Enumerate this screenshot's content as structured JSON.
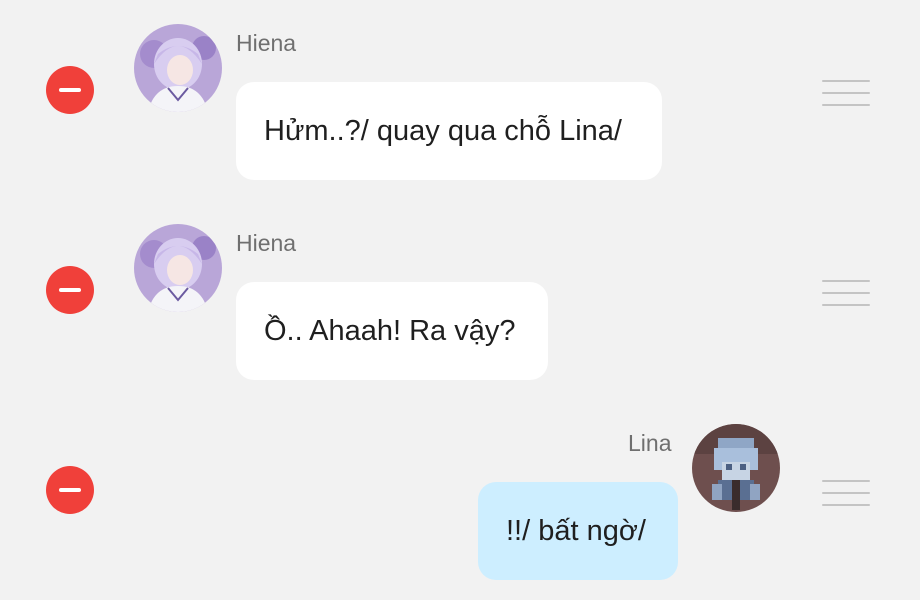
{
  "messages": [
    {
      "sender": "Hiena",
      "text": "Hửm..?/ quay qua chỗ Lina/",
      "side": "left"
    },
    {
      "sender": "Hiena",
      "text": "Ồ.. Ahaah! Ra vậy?",
      "side": "left"
    },
    {
      "sender": "Lina",
      "text": "!!/ bất ngờ/",
      "side": "right"
    }
  ],
  "colors": {
    "background": "#f2f2f2",
    "delete": "#f0403a",
    "incoming_bubble": "#ffffff",
    "outgoing_bubble": "#cdeeff",
    "sender_text": "#6f6f6f"
  },
  "icons": {
    "delete": "minus-circle-icon",
    "reorder": "drag-handle-icon"
  }
}
